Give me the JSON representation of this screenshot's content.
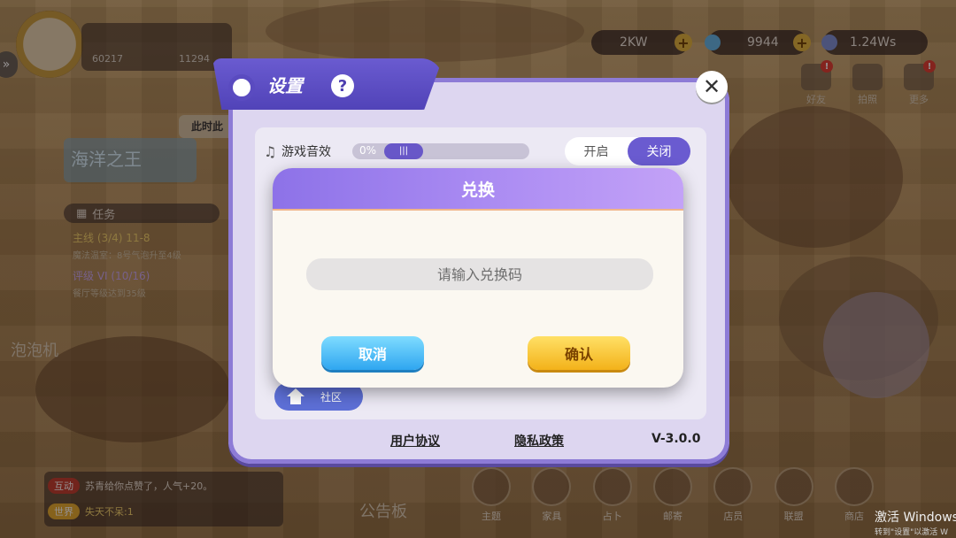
{
  "top_bar": {
    "player_id_1": "60217",
    "player_id_2": "11294",
    "resource_power": "2KW",
    "resource_gems": "9944",
    "resource_time": "1.24Ws"
  },
  "left_panel": {
    "event_title": "海洋之王",
    "quest_header": "任务",
    "quest_main": "主线 (3/4)  11-8",
    "quest_main_sub": "魔法温室：8号气泡升至4级",
    "quest_rank": "评级 VI (10/16)",
    "quest_rank_sub": "餐厅等级达到35级",
    "bubble_machine": "泡泡机",
    "speech": "此时此"
  },
  "chat": {
    "tag1": "互动",
    "msg1": "苏青给你点赞了，人气+20。",
    "tag2": "世界",
    "msg2": "失天不呆:1"
  },
  "top_icons": [
    {
      "label": "好友",
      "badge": "!"
    },
    {
      "label": "拍照",
      "badge": ""
    },
    {
      "label": "更多",
      "badge": "!"
    }
  ],
  "bottom_nav": [
    "主题",
    "家具",
    "占卜",
    "邮寄",
    "店员",
    "联盟",
    "商店"
  ],
  "bulletin": "公告板",
  "settings": {
    "title": "设置",
    "help": "?",
    "sound_label": "游戏音效",
    "slider_value": "0%",
    "toggle_on": "开启",
    "toggle_off": "关闭",
    "community": "社区",
    "user_agreement": "用户协议",
    "privacy_policy": "隐私政策",
    "version": "V-3.0.0"
  },
  "redeem_dialog": {
    "title": "兑换",
    "placeholder": "请输入兑换码",
    "cancel": "取消",
    "confirm": "确认"
  },
  "watermark": {
    "line1": "激活 Windows",
    "line2": "转到\"设置\"以激活 W"
  },
  "colors": {
    "accent_purple": "#6a5bd0",
    "cancel_blue": "#2fa6f0",
    "confirm_yellow": "#f3b21a"
  }
}
